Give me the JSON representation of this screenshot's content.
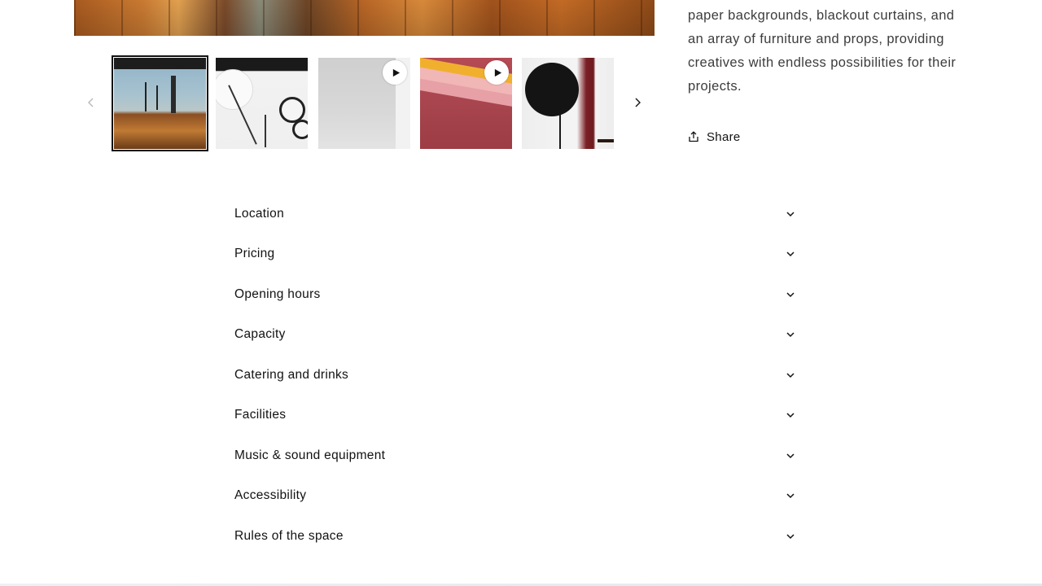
{
  "description_lines": [
    "paper backgrounds, blackout curtains, and",
    "an array of furniture and props, providing",
    "creatives with endless possibilities for their",
    "projects."
  ],
  "share": {
    "label": "Share",
    "icon": "share-icon"
  },
  "gallery": {
    "prev_icon": "chevron-left-icon",
    "next_icon": "chevron-right-icon",
    "thumbnails": [
      {
        "name": "studio-floor",
        "active": true,
        "video": false
      },
      {
        "name": "lighting-equipment",
        "active": false,
        "video": false
      },
      {
        "name": "white-cyclorama",
        "active": false,
        "video": true
      },
      {
        "name": "paper-backdrops",
        "active": false,
        "video": true
      },
      {
        "name": "softbox-setup",
        "active": false,
        "video": false
      }
    ]
  },
  "accordion": {
    "items": [
      {
        "label": "Location"
      },
      {
        "label": "Pricing"
      },
      {
        "label": "Opening hours"
      },
      {
        "label": "Capacity"
      },
      {
        "label": "Catering and drinks"
      },
      {
        "label": "Facilities"
      },
      {
        "label": "Music & sound equipment"
      },
      {
        "label": "Accessibility"
      },
      {
        "label": "Rules of the space"
      }
    ],
    "chevron_icon": "chevron-down-icon"
  }
}
